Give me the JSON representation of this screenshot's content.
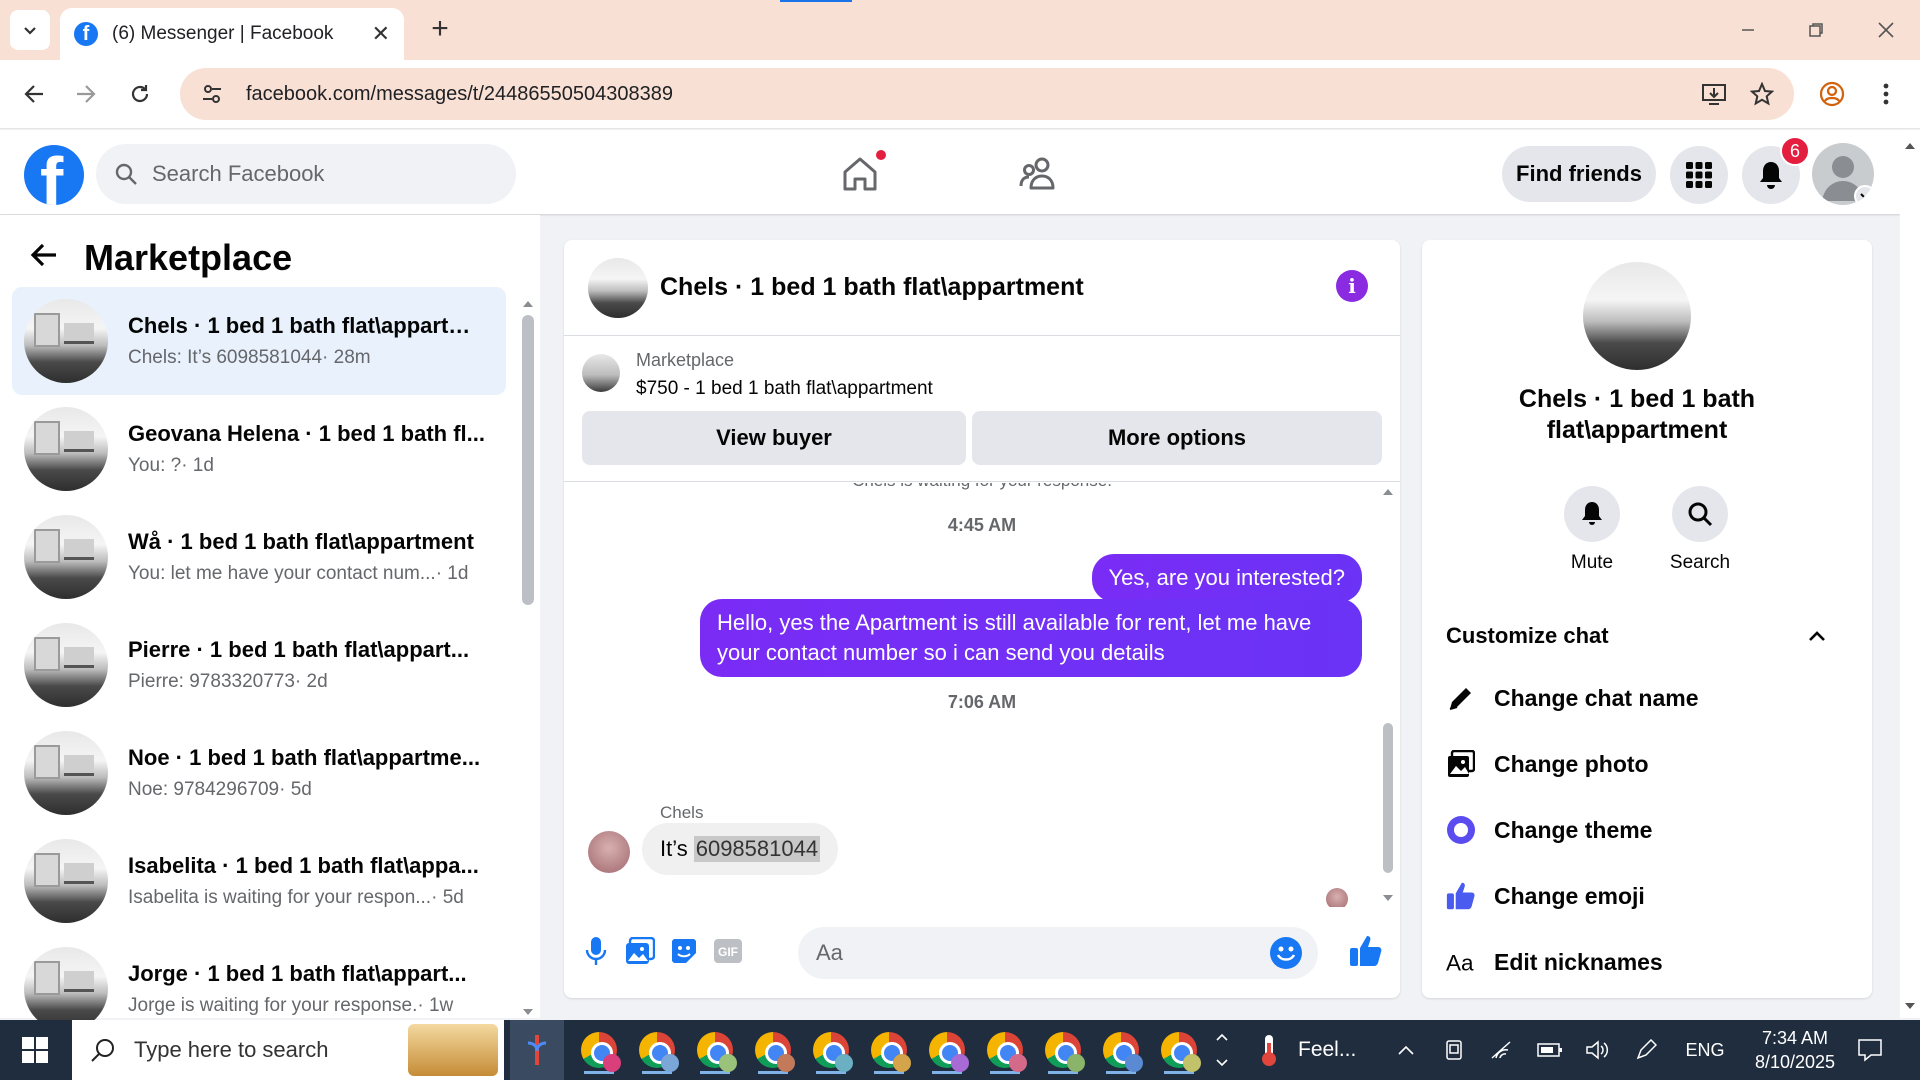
{
  "browser": {
    "tab_title": "(6) Messenger | Facebook",
    "tab_close": "✕",
    "new_tab": "+",
    "url": "facebook.com/messages/t/24486550504308389",
    "icons": [
      "tab-list-icon",
      "facebook-favicon-icon",
      "back-icon",
      "forward-icon",
      "reload-icon",
      "site-info-icon",
      "install-app-icon",
      "bookmark-star-icon",
      "profile-icon",
      "menu-icon",
      "minimize-icon",
      "restore-icon",
      "close-icon"
    ]
  },
  "fb_header": {
    "logo": "f",
    "search_placeholder": "Search Facebook",
    "find_friends": "Find friends",
    "notification_count": "6",
    "brand_color": "#1877f2"
  },
  "left_panel": {
    "title": "Marketplace",
    "conversations": [
      {
        "name": "Chels · 1 bed 1 bath flat\\appartm...",
        "preview": "Chels: It’s 6098581044",
        "time": " · 28m",
        "active": true
      },
      {
        "name": "Geovana Helena · 1 bed 1 bath fl...",
        "preview": "You: ?",
        "time": " · 1d",
        "active": false
      },
      {
        "name": "Wå · 1 bed 1 bath flat\\appartment",
        "preview": "You: let me have your contact num...",
        "time": " · 1d",
        "active": false
      },
      {
        "name": "Pierre · 1 bed 1 bath flat\\appart...",
        "preview": "Pierre: 9783320773",
        "time": " · 2d",
        "active": false
      },
      {
        "name": "Noe · 1 bed 1 bath flat\\appartme...",
        "preview": "Noe: 9784296709",
        "time": " · 5d",
        "active": false
      },
      {
        "name": "Isabelita · 1 bed 1 bath flat\\appa...",
        "preview": "Isabelita is waiting for your respon...",
        "time": " · 5d",
        "active": false
      },
      {
        "name": "Jorge · 1 bed 1 bath flat\\appart...",
        "preview": "Jorge is waiting for your response.",
        "time": " · 1w",
        "active": false
      }
    ]
  },
  "chat": {
    "title": "Chels · 1 bed 1 bath flat\\appartment",
    "info_label": "i",
    "listing_source": "Marketplace",
    "listing_price_title": "$750 - 1 bed 1 bath flat\\appartment",
    "view_buyer": "View buyer",
    "more_options": "More options",
    "waiting_notice": "Chels is waiting for your response.",
    "messages": [
      {
        "type": "timestamp",
        "text": "4:45 AM"
      },
      {
        "type": "outgoing",
        "text": "Yes, are you interested?"
      },
      {
        "type": "outgoing",
        "text": "Hello, yes the Apartment is still available for rent, let me have your contact number so i can send you details"
      },
      {
        "type": "timestamp",
        "text": "7:06 AM"
      },
      {
        "type": "incoming",
        "sender": "Chels",
        "prefix": "It’s",
        "highlight": "6098581044"
      }
    ],
    "input_placeholder": "Aa",
    "accent_color": "#7a2cf5"
  },
  "right_panel": {
    "name": "Chels · 1 bed 1 bath flat\\appartment",
    "actions": [
      {
        "label": "Mute",
        "icon": "bell-icon"
      },
      {
        "label": "Search",
        "icon": "search-icon"
      }
    ],
    "section_title": "Customize chat",
    "options": [
      {
        "label": "Change chat name",
        "icon": "pencil-icon"
      },
      {
        "label": "Change photo",
        "icon": "photo-icon"
      },
      {
        "label": "Change theme",
        "icon": "theme-icon"
      },
      {
        "label": "Change emoji",
        "icon": "thumbs-up-icon"
      },
      {
        "label": "Edit nicknames",
        "icon": "text-aa-icon"
      }
    ]
  },
  "taskbar": {
    "search_placeholder": "Type here to search",
    "weather": "Feel...",
    "language": "ENG",
    "time": "7:34 AM",
    "date": "8/10/2025"
  }
}
